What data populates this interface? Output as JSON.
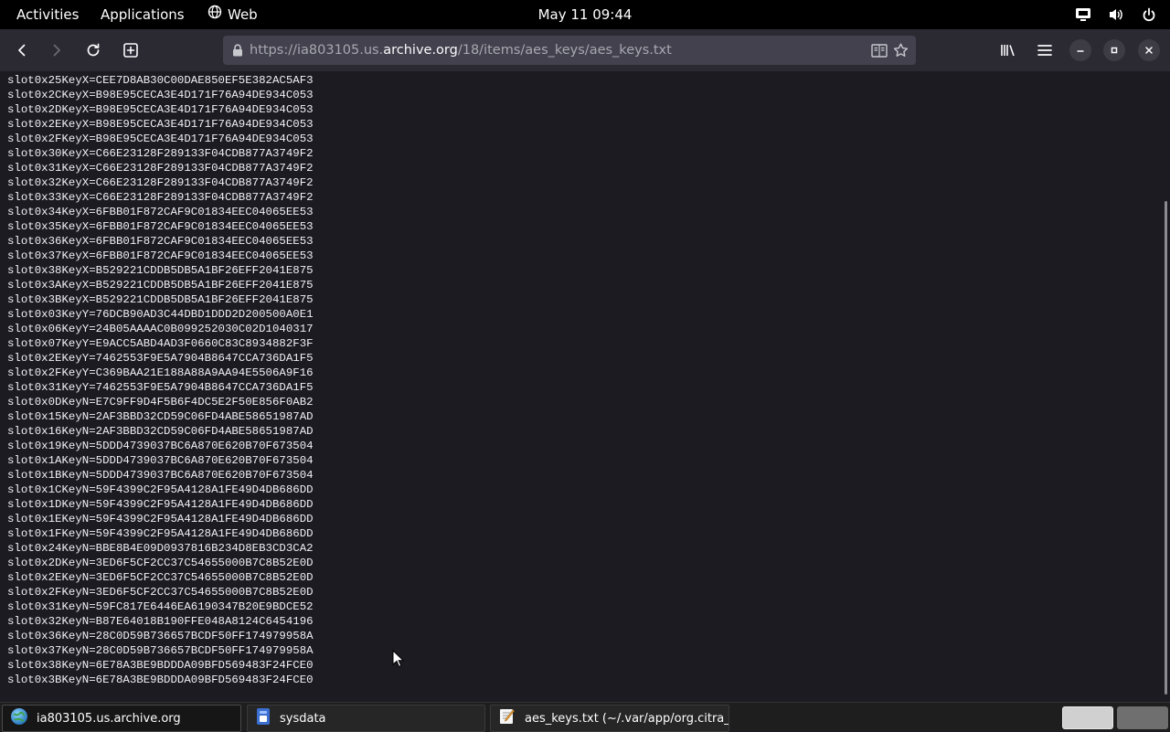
{
  "topbar": {
    "activities": "Activities",
    "applications": "Applications",
    "web": "Web",
    "clock": "May 11  09:44"
  },
  "browser": {
    "url_prefix": "https://ia803105.us.",
    "url_domain": "archive.org",
    "url_path": "/18/items/aes_keys/aes_keys.txt"
  },
  "content": {
    "lines": [
      "slot0x25KeyX=CEE7D8AB30C00DAE850EF5E382AC5AF3",
      "slot0x2CKeyX=B98E95CECA3E4D171F76A94DE934C053",
      "slot0x2DKeyX=B98E95CECA3E4D171F76A94DE934C053",
      "slot0x2EKeyX=B98E95CECA3E4D171F76A94DE934C053",
      "slot0x2FKeyX=B98E95CECA3E4D171F76A94DE934C053",
      "slot0x30KeyX=C66E23128F289133F04CDB877A3749F2",
      "slot0x31KeyX=C66E23128F289133F04CDB877A3749F2",
      "slot0x32KeyX=C66E23128F289133F04CDB877A3749F2",
      "slot0x33KeyX=C66E23128F289133F04CDB877A3749F2",
      "slot0x34KeyX=6FBB01F872CAF9C01834EEC04065EE53",
      "slot0x35KeyX=6FBB01F872CAF9C01834EEC04065EE53",
      "slot0x36KeyX=6FBB01F872CAF9C01834EEC04065EE53",
      "slot0x37KeyX=6FBB01F872CAF9C01834EEC04065EE53",
      "slot0x38KeyX=B529221CDDB5DB5A1BF26EFF2041E875",
      "slot0x3AKeyX=B529221CDDB5DB5A1BF26EFF2041E875",
      "slot0x3BKeyX=B529221CDDB5DB5A1BF26EFF2041E875",
      "slot0x03KeyY=76DCB90AD3C44DBD1DDD2D200500A0E1",
      "slot0x06KeyY=24B05AAAAC0B099252030C02D1040317",
      "slot0x07KeyY=E9ACC5ABD4AD3F0660C83C8934882F3F",
      "slot0x2EKeyY=7462553F9E5A7904B8647CCA736DA1F5",
      "slot0x2FKeyY=C369BAA21E188A88A9AA94E5506A9F16",
      "slot0x31KeyY=7462553F9E5A7904B8647CCA736DA1F5",
      "slot0x0DKeyN=E7C9FF9D4F5B6F4DC5E2F50E856F0AB2",
      "slot0x15KeyN=2AF3BBD32CD59C06FD4ABE58651987AD",
      "slot0x16KeyN=2AF3BBD32CD59C06FD4ABE58651987AD",
      "slot0x19KeyN=5DDD4739037BC6A870E620B70F673504",
      "slot0x1AKeyN=5DDD4739037BC6A870E620B70F673504",
      "slot0x1BKeyN=5DDD4739037BC6A870E620B70F673504",
      "slot0x1CKeyN=59F4399C2F95A4128A1FE49D4DB686DD",
      "slot0x1DKeyN=59F4399C2F95A4128A1FE49D4DB686DD",
      "slot0x1EKeyN=59F4399C2F95A4128A1FE49D4DB686DD",
      "slot0x1FKeyN=59F4399C2F95A4128A1FE49D4DB686DD",
      "slot0x24KeyN=BBE8B4E09D0937816B234D8EB3CD3CA2",
      "slot0x2DKeyN=3ED6F5CF2CC37C54655000B7C8B52E0D",
      "slot0x2EKeyN=3ED6F5CF2CC37C54655000B7C8B52E0D",
      "slot0x2FKeyN=3ED6F5CF2CC37C54655000B7C8B52E0D",
      "slot0x31KeyN=59FC817E6446EA6190347B20E9BDCE52",
      "slot0x32KeyN=B87E64018B190FFE048A8124C6454196",
      "slot0x36KeyN=28C0D59B736657BCDF50FF174979958A",
      "slot0x37KeyN=28C0D59B736657BCDF50FF174979958A",
      "slot0x38KeyN=6E78A3BE9BDDDA09BFD569483F24FCE0",
      "slot0x3BKeyN=6E78A3BE9BDDDA09BFD569483F24FCE0"
    ]
  },
  "taskbar": {
    "items": [
      {
        "label": "ia803105.us.archive.org",
        "icon": "globe-icon"
      },
      {
        "label": "sysdata",
        "icon": "file-manager-icon"
      },
      {
        "label": "aes_keys.txt (~/.var/app/org.citra_...",
        "icon": "text-editor-icon"
      }
    ]
  }
}
